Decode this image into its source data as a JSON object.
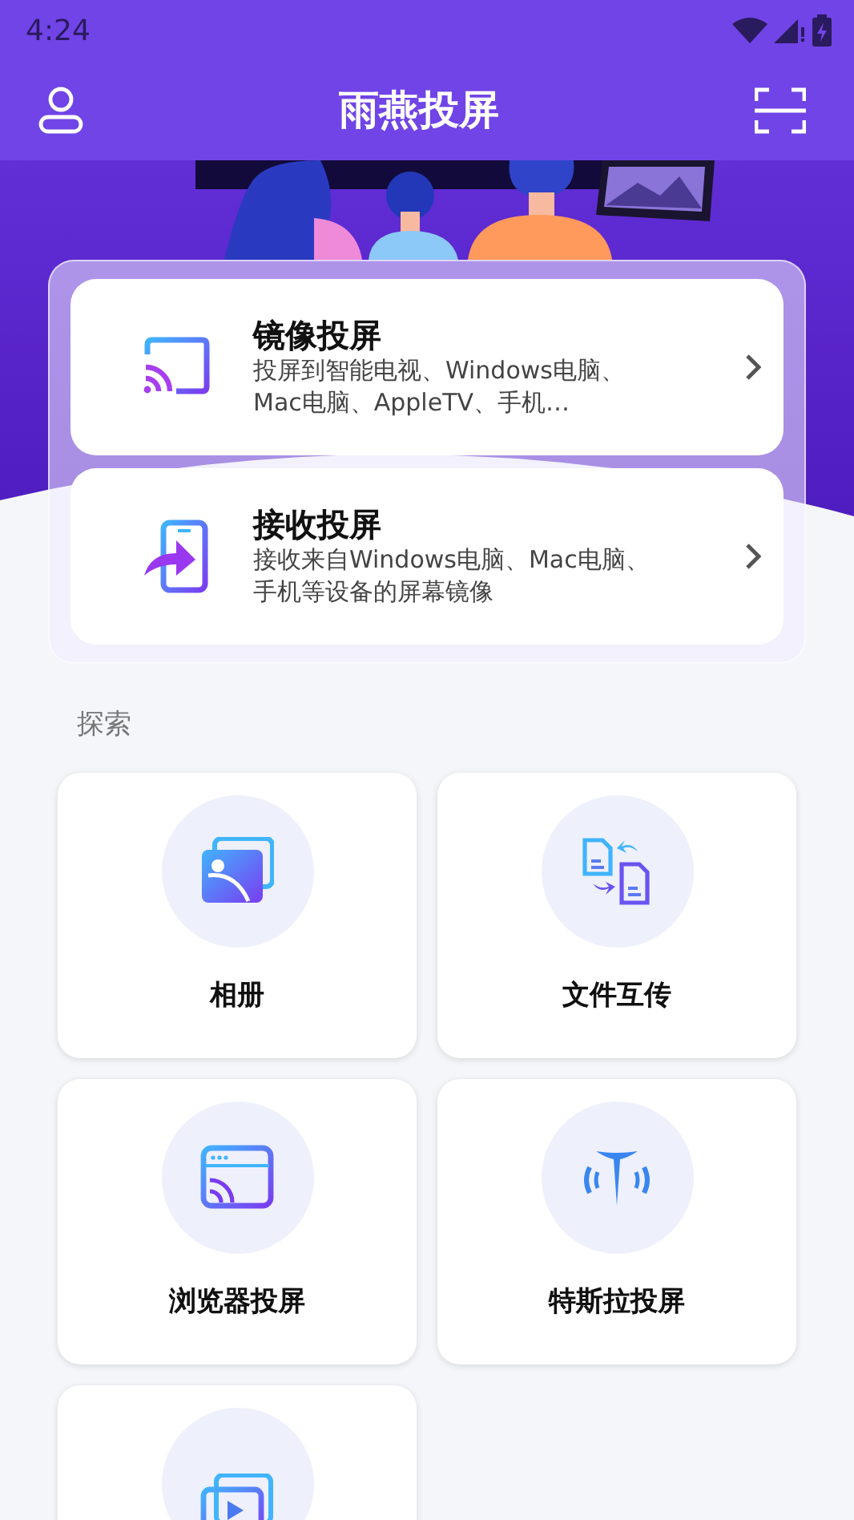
{
  "status_bar": {
    "time": "4:24"
  },
  "app_bar": {
    "title": "雨燕投屏"
  },
  "cast_options": [
    {
      "title": "镜像投屏",
      "description": "投屏到智能电视、Windows电脑、Mac电脑、AppleTV、手机…"
    },
    {
      "title": "接收投屏",
      "description": "接收来自Windows电脑、Mac电脑、手机等设备的屏幕镜像"
    }
  ],
  "explore": {
    "heading": "探索",
    "tiles": [
      {
        "kind": "tile",
        "label": "相册"
      },
      {
        "kind": "tile",
        "label": "文件互传"
      },
      {
        "kind": "tile",
        "label": "浏览器投屏"
      },
      {
        "kind": "tile",
        "label": "特斯拉投屏"
      },
      {
        "kind": "tile-cut"
      }
    ]
  }
}
